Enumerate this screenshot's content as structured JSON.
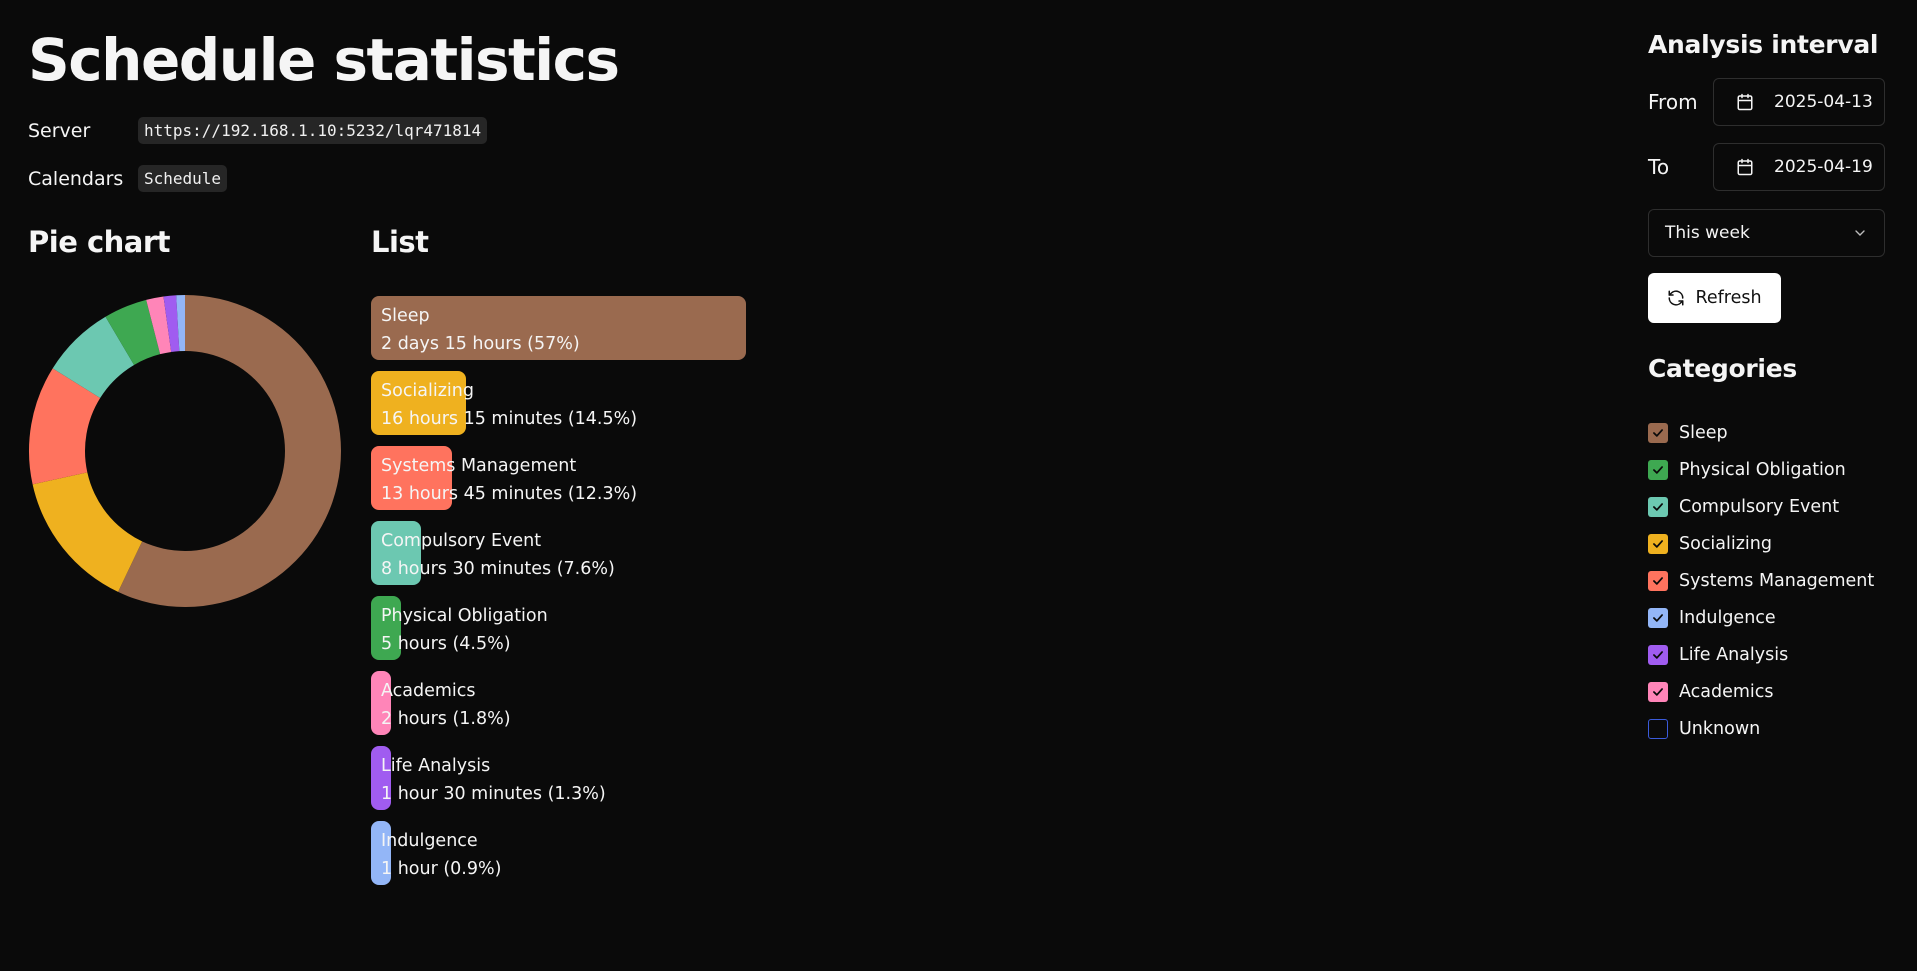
{
  "title": "Schedule statistics",
  "server": {
    "label": "Server",
    "value": "https://192.168.1.10:5232/lqr471814"
  },
  "calendars": {
    "label": "Calendars",
    "value": "Schedule"
  },
  "pie": {
    "heading": "Pie chart"
  },
  "list": {
    "heading": "List",
    "items": [
      {
        "name": "Sleep",
        "detail": "2 days 15 hours (57%)",
        "percent": 57,
        "color": "#9a6a4f"
      },
      {
        "name": "Socializing",
        "detail": "16 hours 15 minutes (14.5%)",
        "percent": 14.5,
        "color": "#efb11f"
      },
      {
        "name": "Systems Management",
        "detail": "13 hours 45 minutes (12.3%)",
        "percent": 12.3,
        "color": "#ff735e"
      },
      {
        "name": "Compulsory Event",
        "detail": "8 hours 30 minutes (7.6%)",
        "percent": 7.6,
        "color": "#6cc8b1"
      },
      {
        "name": "Physical Obligation",
        "detail": "5 hours (4.5%)",
        "percent": 4.5,
        "color": "#3ea851"
      },
      {
        "name": "Academics",
        "detail": "2 hours (1.8%)",
        "percent": 1.8,
        "color": "#ff85b8"
      },
      {
        "name": "Life Analysis",
        "detail": "1 hour 30 minutes (1.3%)",
        "percent": 1.3,
        "color": "#a05cf0"
      },
      {
        "name": "Indulgence",
        "detail": "1 hour (0.9%)",
        "percent": 0.9,
        "color": "#93b6f7"
      }
    ]
  },
  "chart_data": {
    "type": "pie",
    "categories": [
      "Sleep",
      "Socializing",
      "Systems Management",
      "Compulsory Event",
      "Physical Obligation",
      "Academics",
      "Life Analysis",
      "Indulgence"
    ],
    "values": [
      57,
      14.5,
      12.3,
      7.6,
      4.5,
      1.8,
      1.3,
      0.9
    ],
    "colors": [
      "#9a6a4f",
      "#efb11f",
      "#ff735e",
      "#6cc8b1",
      "#3ea851",
      "#ff85b8",
      "#a05cf0",
      "#93b6f7"
    ],
    "title": ""
  },
  "interval": {
    "heading": "Analysis interval",
    "from_label": "From",
    "from_value": "2025-04-13",
    "to_label": "To",
    "to_value": "2025-04-19",
    "preset": "This week",
    "refresh_label": "Refresh"
  },
  "categories": {
    "heading": "Categories",
    "items": [
      {
        "name": "Sleep",
        "checked": true,
        "color": "#9a6a4f"
      },
      {
        "name": "Physical Obligation",
        "checked": true,
        "color": "#3ea851"
      },
      {
        "name": "Compulsory Event",
        "checked": true,
        "color": "#6cc8b1"
      },
      {
        "name": "Socializing",
        "checked": true,
        "color": "#efb11f"
      },
      {
        "name": "Systems Management",
        "checked": true,
        "color": "#ff735e"
      },
      {
        "name": "Indulgence",
        "checked": true,
        "color": "#93b6f7"
      },
      {
        "name": "Life Analysis",
        "checked": true,
        "color": "#a05cf0"
      },
      {
        "name": "Academics",
        "checked": true,
        "color": "#ff85b8"
      },
      {
        "name": "Unknown",
        "checked": false,
        "color": "#3b5bdb"
      }
    ]
  }
}
